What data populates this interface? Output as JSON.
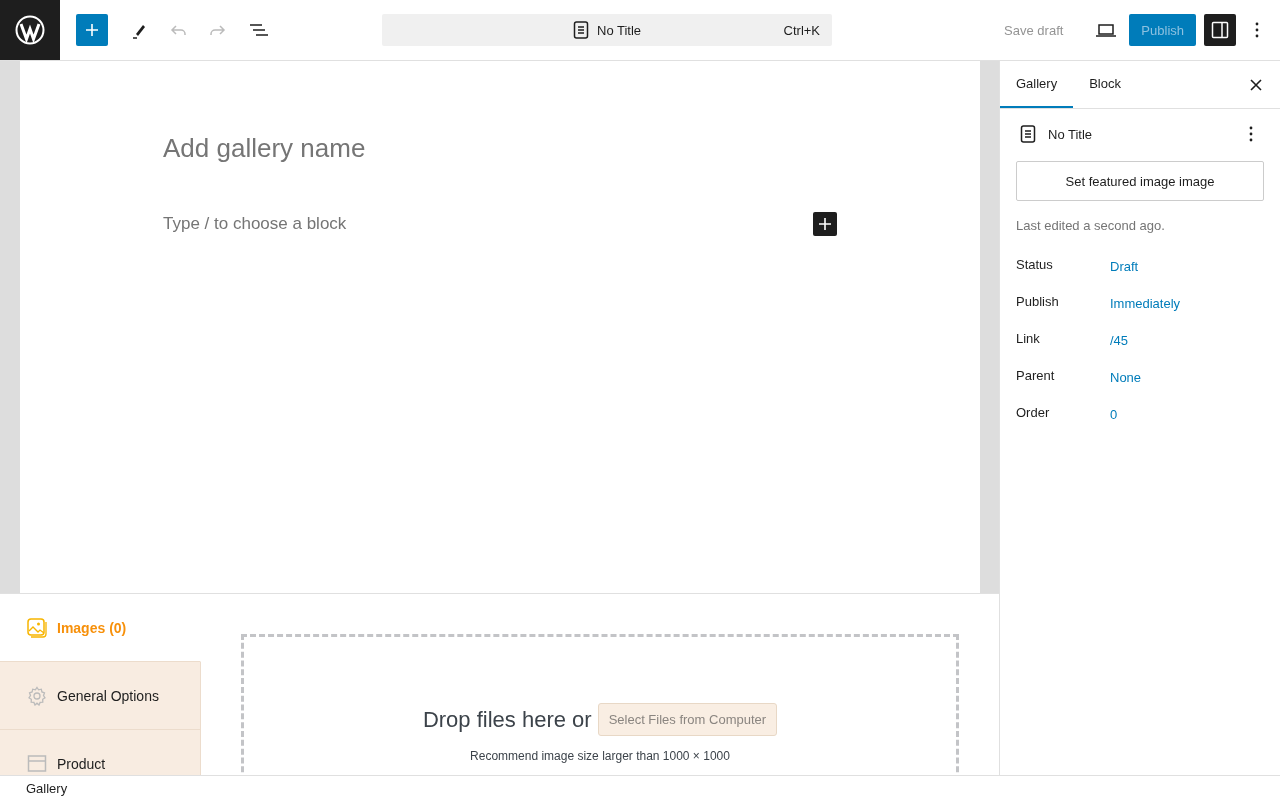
{
  "toolbar": {
    "document_title": "No Title",
    "shortcut": "Ctrl+K",
    "save_draft": "Save draft",
    "publish": "Publish",
    "sidebar_toggle_on": true
  },
  "editor": {
    "title_placeholder": "Add gallery name",
    "block_placeholder": "Type / to choose a block"
  },
  "gallery_panel": {
    "tabs": [
      {
        "label": "Images (0)",
        "selected": true
      },
      {
        "label": "General Options",
        "selected": false
      },
      {
        "label": "Product",
        "selected": false
      }
    ],
    "dropzone": {
      "text": "Drop files here or",
      "button": "Select Files from Computer",
      "hint": "Recommend image size larger than 1000 × 1000"
    }
  },
  "sidebar": {
    "tabs": [
      {
        "label": "Gallery",
        "selected": true
      },
      {
        "label": "Block",
        "selected": false
      }
    ],
    "post_title": "No Title",
    "featured_image_button": "Set featured image image",
    "last_edited": "Last edited a second ago.",
    "fields": [
      {
        "label": "Status",
        "value": "Draft"
      },
      {
        "label": "Publish",
        "value": "Immediately"
      },
      {
        "label": "Link",
        "value": "/45"
      },
      {
        "label": "Parent",
        "value": "None"
      },
      {
        "label": "Order",
        "value": "0"
      }
    ]
  },
  "status_bar": {
    "breadcrumb": "Gallery"
  }
}
